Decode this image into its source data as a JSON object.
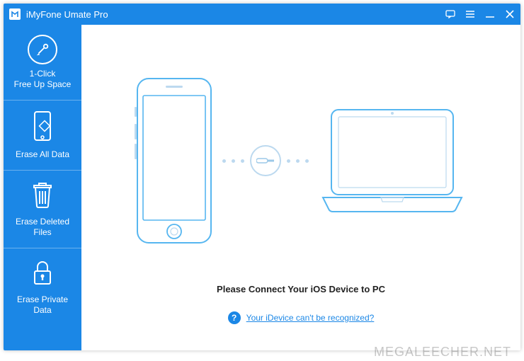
{
  "titlebar": {
    "app_name": "iMyFone Umate Pro"
  },
  "sidebar": {
    "items": [
      {
        "id": "free-up",
        "label": "1-Click\nFree Up Space",
        "icon": "broom-icon"
      },
      {
        "id": "erase-all",
        "label": "Erase All Data",
        "icon": "phone-erase-icon"
      },
      {
        "id": "erase-deleted",
        "label": "Erase Deleted\nFiles",
        "icon": "trash-icon"
      },
      {
        "id": "erase-private",
        "label": "Erase Private\nData",
        "icon": "lock-icon"
      }
    ]
  },
  "main": {
    "prompt": "Please Connect Your iOS Device to PC",
    "help_text": "Your iDevice can't be recognized?"
  },
  "watermark": "MEGALEECHER.NET",
  "colors": {
    "accent": "#1B87E6",
    "illustration_stroke": "#56b6f0",
    "illustration_light": "#bcd9ef"
  }
}
